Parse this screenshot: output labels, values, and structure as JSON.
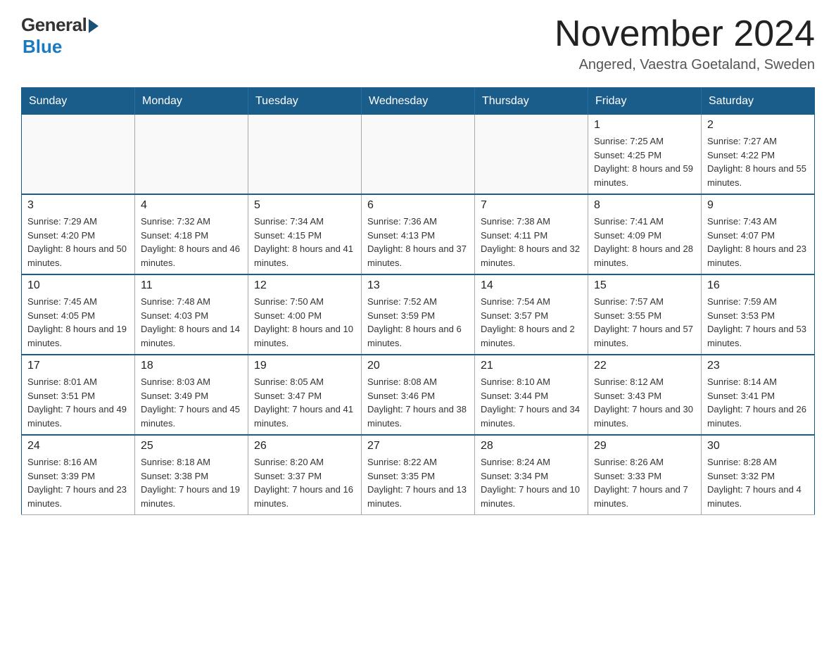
{
  "header": {
    "logo_general": "General",
    "logo_blue": "Blue",
    "month_title": "November 2024",
    "location": "Angered, Vaestra Goetaland, Sweden"
  },
  "weekdays": [
    "Sunday",
    "Monday",
    "Tuesday",
    "Wednesday",
    "Thursday",
    "Friday",
    "Saturday"
  ],
  "weeks": [
    [
      {
        "day": "",
        "info": ""
      },
      {
        "day": "",
        "info": ""
      },
      {
        "day": "",
        "info": ""
      },
      {
        "day": "",
        "info": ""
      },
      {
        "day": "",
        "info": ""
      },
      {
        "day": "1",
        "info": "Sunrise: 7:25 AM\nSunset: 4:25 PM\nDaylight: 8 hours and 59 minutes."
      },
      {
        "day": "2",
        "info": "Sunrise: 7:27 AM\nSunset: 4:22 PM\nDaylight: 8 hours and 55 minutes."
      }
    ],
    [
      {
        "day": "3",
        "info": "Sunrise: 7:29 AM\nSunset: 4:20 PM\nDaylight: 8 hours and 50 minutes."
      },
      {
        "day": "4",
        "info": "Sunrise: 7:32 AM\nSunset: 4:18 PM\nDaylight: 8 hours and 46 minutes."
      },
      {
        "day": "5",
        "info": "Sunrise: 7:34 AM\nSunset: 4:15 PM\nDaylight: 8 hours and 41 minutes."
      },
      {
        "day": "6",
        "info": "Sunrise: 7:36 AM\nSunset: 4:13 PM\nDaylight: 8 hours and 37 minutes."
      },
      {
        "day": "7",
        "info": "Sunrise: 7:38 AM\nSunset: 4:11 PM\nDaylight: 8 hours and 32 minutes."
      },
      {
        "day": "8",
        "info": "Sunrise: 7:41 AM\nSunset: 4:09 PM\nDaylight: 8 hours and 28 minutes."
      },
      {
        "day": "9",
        "info": "Sunrise: 7:43 AM\nSunset: 4:07 PM\nDaylight: 8 hours and 23 minutes."
      }
    ],
    [
      {
        "day": "10",
        "info": "Sunrise: 7:45 AM\nSunset: 4:05 PM\nDaylight: 8 hours and 19 minutes."
      },
      {
        "day": "11",
        "info": "Sunrise: 7:48 AM\nSunset: 4:03 PM\nDaylight: 8 hours and 14 minutes."
      },
      {
        "day": "12",
        "info": "Sunrise: 7:50 AM\nSunset: 4:00 PM\nDaylight: 8 hours and 10 minutes."
      },
      {
        "day": "13",
        "info": "Sunrise: 7:52 AM\nSunset: 3:59 PM\nDaylight: 8 hours and 6 minutes."
      },
      {
        "day": "14",
        "info": "Sunrise: 7:54 AM\nSunset: 3:57 PM\nDaylight: 8 hours and 2 minutes."
      },
      {
        "day": "15",
        "info": "Sunrise: 7:57 AM\nSunset: 3:55 PM\nDaylight: 7 hours and 57 minutes."
      },
      {
        "day": "16",
        "info": "Sunrise: 7:59 AM\nSunset: 3:53 PM\nDaylight: 7 hours and 53 minutes."
      }
    ],
    [
      {
        "day": "17",
        "info": "Sunrise: 8:01 AM\nSunset: 3:51 PM\nDaylight: 7 hours and 49 minutes."
      },
      {
        "day": "18",
        "info": "Sunrise: 8:03 AM\nSunset: 3:49 PM\nDaylight: 7 hours and 45 minutes."
      },
      {
        "day": "19",
        "info": "Sunrise: 8:05 AM\nSunset: 3:47 PM\nDaylight: 7 hours and 41 minutes."
      },
      {
        "day": "20",
        "info": "Sunrise: 8:08 AM\nSunset: 3:46 PM\nDaylight: 7 hours and 38 minutes."
      },
      {
        "day": "21",
        "info": "Sunrise: 8:10 AM\nSunset: 3:44 PM\nDaylight: 7 hours and 34 minutes."
      },
      {
        "day": "22",
        "info": "Sunrise: 8:12 AM\nSunset: 3:43 PM\nDaylight: 7 hours and 30 minutes."
      },
      {
        "day": "23",
        "info": "Sunrise: 8:14 AM\nSunset: 3:41 PM\nDaylight: 7 hours and 26 minutes."
      }
    ],
    [
      {
        "day": "24",
        "info": "Sunrise: 8:16 AM\nSunset: 3:39 PM\nDaylight: 7 hours and 23 minutes."
      },
      {
        "day": "25",
        "info": "Sunrise: 8:18 AM\nSunset: 3:38 PM\nDaylight: 7 hours and 19 minutes."
      },
      {
        "day": "26",
        "info": "Sunrise: 8:20 AM\nSunset: 3:37 PM\nDaylight: 7 hours and 16 minutes."
      },
      {
        "day": "27",
        "info": "Sunrise: 8:22 AM\nSunset: 3:35 PM\nDaylight: 7 hours and 13 minutes."
      },
      {
        "day": "28",
        "info": "Sunrise: 8:24 AM\nSunset: 3:34 PM\nDaylight: 7 hours and 10 minutes."
      },
      {
        "day": "29",
        "info": "Sunrise: 8:26 AM\nSunset: 3:33 PM\nDaylight: 7 hours and 7 minutes."
      },
      {
        "day": "30",
        "info": "Sunrise: 8:28 AM\nSunset: 3:32 PM\nDaylight: 7 hours and 4 minutes."
      }
    ]
  ]
}
